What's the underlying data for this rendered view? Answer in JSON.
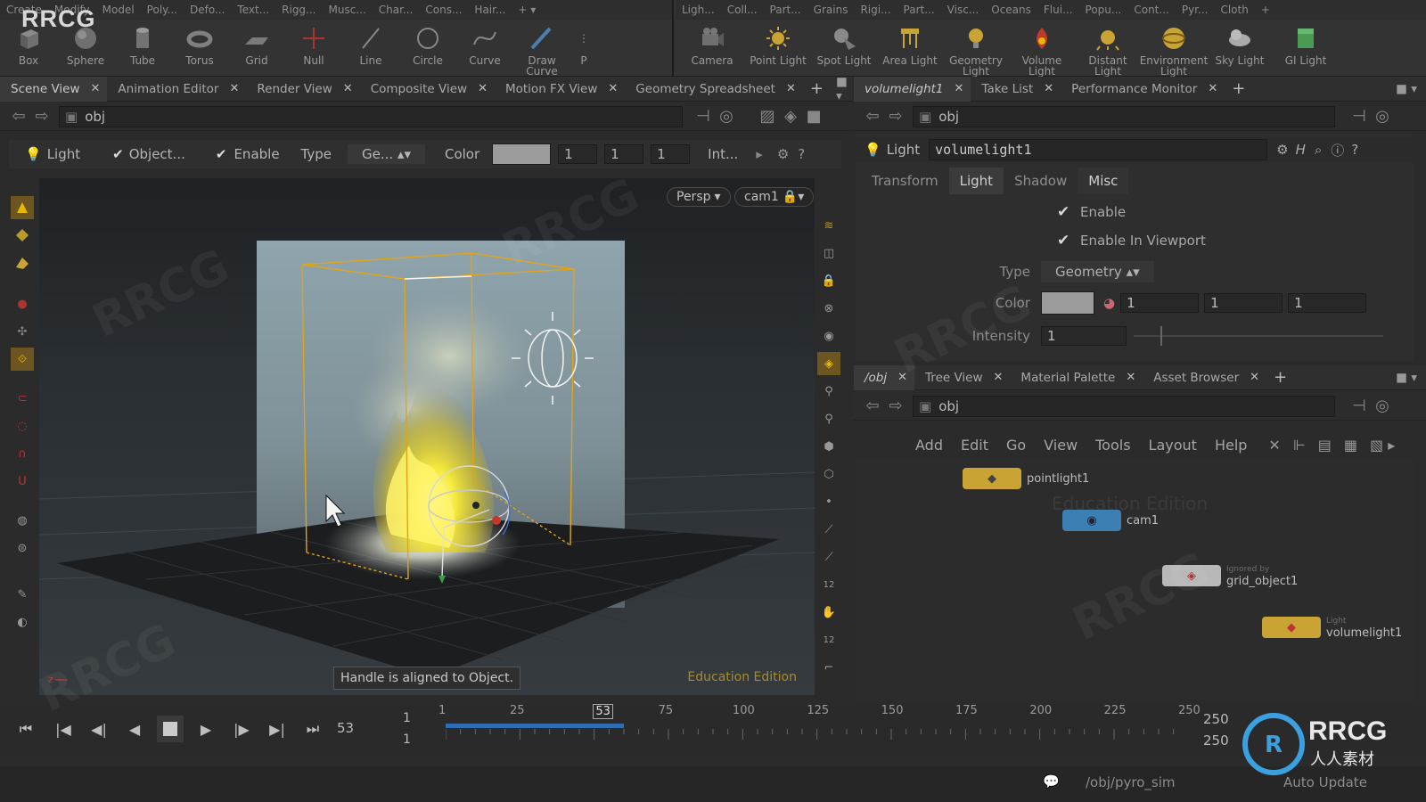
{
  "shelf": {
    "logo": "RRCG",
    "left_tabs": [
      "Create",
      "Modify",
      "Model",
      "Poly...",
      "Defo...",
      "Text...",
      "Rigg...",
      "Musc...",
      "Char...",
      "Cons...",
      "Hair..."
    ],
    "left_tools": [
      "Box",
      "Sphere",
      "Tube",
      "Torus",
      "Grid",
      "Null",
      "Line",
      "Circle",
      "Curve",
      "Draw Curve",
      "P"
    ],
    "right_tabs": [
      "Ligh...",
      "Coll...",
      "Part...",
      "Grains",
      "Rigi...",
      "Part...",
      "Visc...",
      "Oceans",
      "Flui...",
      "Popu...",
      "Cont...",
      "Pyr...",
      "Cloth"
    ],
    "right_tools": [
      "Camera",
      "Point Light",
      "Spot Light",
      "Area Light",
      "Geometry Light",
      "Volume Light",
      "Distant Light",
      "Environment Light",
      "Sky Light",
      "GI Light"
    ]
  },
  "left_pane": {
    "tabs": [
      "Scene View",
      "Animation Editor",
      "Render View",
      "Composite View",
      "Motion FX View",
      "Geometry Spreadsheet"
    ],
    "path": "obj"
  },
  "op_bar": {
    "light_label": "Light",
    "object_label": "Object...",
    "enable_label": "Enable",
    "type_label": "Type",
    "type_value": "Ge...",
    "color_label": "Color",
    "color_values": [
      "1",
      "1",
      "1"
    ],
    "intensity_label": "Int..."
  },
  "viewport": {
    "persp_label": "Persp",
    "camera_label": "cam1",
    "hint": "Handle is aligned to Object.",
    "edition": "Education Edition",
    "axis_label": "Z X"
  },
  "right_top": {
    "tabs": [
      "volumelight1",
      "Take List",
      "Performance Monitor"
    ],
    "path": "obj",
    "node_type": "Light",
    "node_name": "volumelight1",
    "param_tabs": [
      "Transform",
      "Light",
      "Shadow",
      "Misc"
    ],
    "enable_label": "Enable",
    "enable_viewport_label": "Enable In Viewport",
    "type_label": "Type",
    "type_value": "Geometry",
    "color_label": "Color",
    "color_values": [
      "1",
      "1",
      "1"
    ],
    "intensity_label": "Intensity",
    "intensity_value": "1"
  },
  "right_bottom": {
    "tabs": [
      "/obj",
      "Tree View",
      "Material Palette",
      "Asset Browser"
    ],
    "path": "obj",
    "menu": [
      "Add",
      "Edit",
      "Go",
      "View",
      "Tools",
      "Layout",
      "Help"
    ],
    "ghost_label": "Education Edition",
    "nodes": [
      {
        "label": "pointlight1",
        "color": "#c9a334",
        "sub": ""
      },
      {
        "label": "cam1",
        "color": "#3b7fb3",
        "sub": ""
      },
      {
        "label": "grid_object1",
        "color": "#b8b8b8",
        "sub": "Ignored by"
      },
      {
        "label": "volumelight1",
        "color": "#c9a334",
        "sub": "Light"
      }
    ]
  },
  "timeline": {
    "current_frame": "53",
    "start_frame": "1",
    "range_start": "1",
    "end_frame": "250",
    "end_frame2": "250",
    "ticks": [
      "1",
      "25",
      "53",
      "75",
      "100",
      "125",
      "150",
      "175",
      "200",
      "225",
      "250"
    ]
  },
  "status": {
    "path": "/obj/pyro_sim",
    "update_mode": "Auto Update"
  },
  "brand": {
    "name": "RRCG",
    "subtitle": "人人素材"
  },
  "colors": {
    "accent_yellow": "#e6b800",
    "fire": "#f4e03a",
    "selection_blue": "#2f6db3"
  }
}
